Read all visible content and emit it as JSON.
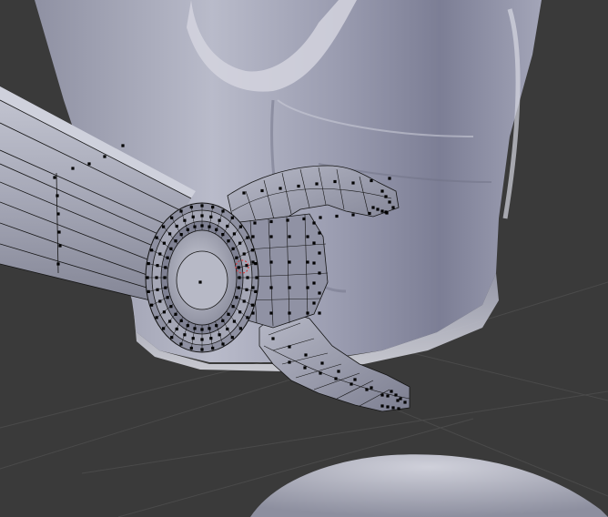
{
  "viewport": {
    "mode": "edit-mode",
    "shading": "solid",
    "background_color": "#3a3a3a",
    "grid_color": "#4a4a4a",
    "mesh_color": "#a6a8b8",
    "wire_color": "#141414",
    "vertex_color": "#000000",
    "active_vertex_color": "#e03030"
  },
  "objects": [
    {
      "name": "body",
      "type": "mesh"
    },
    {
      "name": "arm",
      "type": "mesh",
      "edit_mode": true
    },
    {
      "name": "claw",
      "type": "mesh",
      "edit_mode": true
    },
    {
      "name": "base",
      "type": "mesh"
    }
  ]
}
